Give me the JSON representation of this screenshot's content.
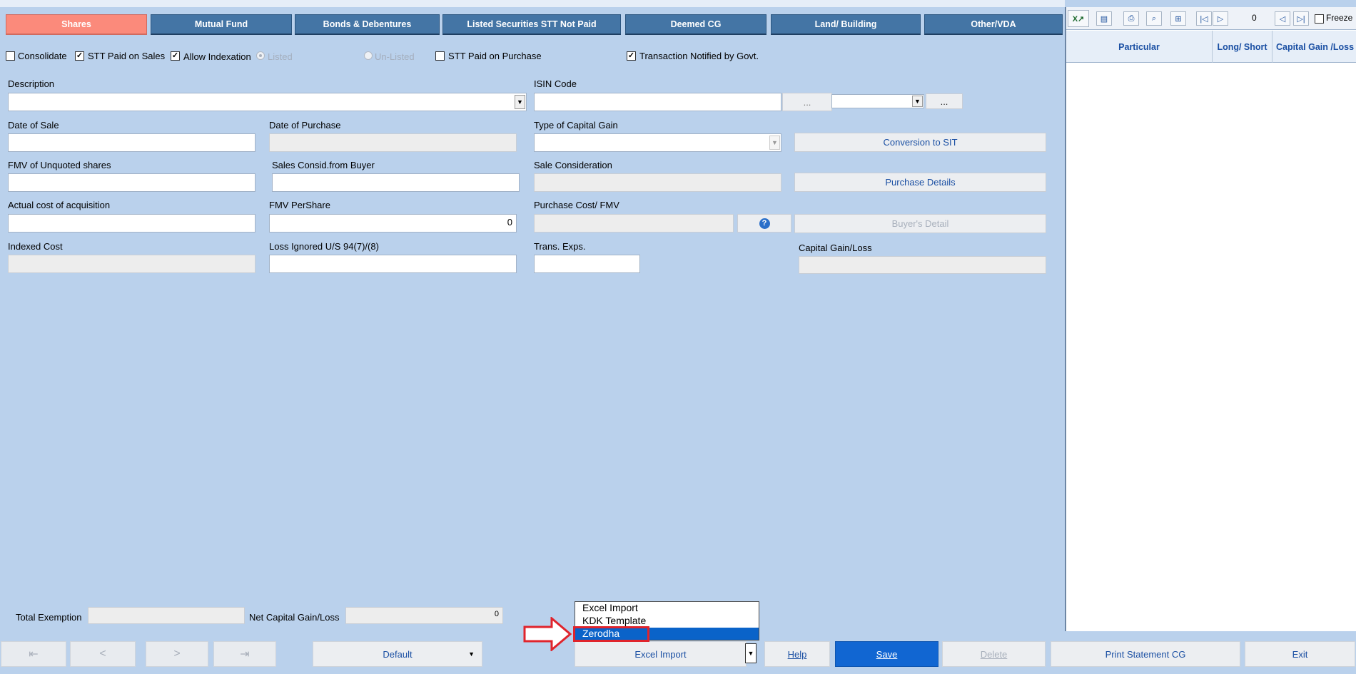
{
  "tabs": [
    {
      "label": "Shares",
      "active": true
    },
    {
      "label": "Mutual Fund",
      "active": false
    },
    {
      "label": "Bonds & Debentures",
      "active": false
    },
    {
      "label": "Listed Securities STT Not Paid",
      "active": false
    },
    {
      "label": "Deemed CG",
      "active": false
    },
    {
      "label": "Land/ Building",
      "active": false
    },
    {
      "label": "Other/VDA",
      "active": false
    }
  ],
  "options": {
    "consolidate": {
      "label": "Consolidate",
      "checked": false
    },
    "stt_paid_on_sales": {
      "label": "STT Paid on Sales",
      "checked": true
    },
    "allow_indexation": {
      "label": "Allow Indexation",
      "checked": true
    },
    "listed": {
      "label": "Listed",
      "selected": true,
      "disabled": true
    },
    "unlisted": {
      "label": "Un-Listed",
      "selected": false,
      "disabled": true
    },
    "stt_paid_on_purchase": {
      "label": "STT Paid on Purchase",
      "checked": false
    },
    "transaction_notified": {
      "label": "Transaction Notified by Govt.",
      "checked": true
    }
  },
  "form": {
    "description": {
      "label": "Description",
      "value": ""
    },
    "isin_code": {
      "label": "ISIN Code",
      "value": "",
      "browse": "...",
      "browse2": "..."
    },
    "date_of_sale": {
      "label": "Date of Sale",
      "value": ""
    },
    "date_of_purchase": {
      "label": "Date of Purchase",
      "value": ""
    },
    "type_of_capital_gain": {
      "label": "Type of Capital Gain",
      "value": ""
    },
    "conversion_to_sit": "Conversion to SIT",
    "fmv_unquoted": {
      "label": "FMV of Unquoted shares",
      "value": ""
    },
    "sales_consid_buyer": {
      "label": "Sales Consid.from Buyer",
      "value": ""
    },
    "sale_consideration": {
      "label": "Sale Consideration",
      "value": ""
    },
    "purchase_details": "Purchase Details",
    "actual_cost": {
      "label": "Actual cost of acquisition",
      "value": ""
    },
    "fmv_per_share": {
      "label": "FMV PerShare",
      "value": "0"
    },
    "purchase_cost_fmv": {
      "label": "Purchase Cost/ FMV",
      "value": ""
    },
    "help_icon": "?",
    "buyers_detail": "Buyer's Detail",
    "indexed_cost": {
      "label": "Indexed Cost",
      "value": ""
    },
    "loss_ignored": {
      "label": "Loss Ignored U/S 94(7)/(8)",
      "value": ""
    },
    "trans_exps": {
      "label": "Trans. Exps.",
      "value": ""
    },
    "capital_gain_loss": {
      "label": "Capital Gain/Loss",
      "value": ""
    }
  },
  "totals": {
    "total_exemption": {
      "label": "Total Exemption",
      "value": ""
    },
    "net_capital_gain": {
      "label": "Net Capital Gain/Loss",
      "value": "0"
    }
  },
  "right_pane": {
    "page_number": "0",
    "freeze_label": "Freeze",
    "columns": [
      "Particular",
      "Long/ Short",
      "Capital Gain /Loss"
    ]
  },
  "bottom": {
    "nav_first": "⇤",
    "nav_prev": "<",
    "nav_next": ">",
    "nav_last": "⇥",
    "default_select": "Default",
    "import_select": "Excel Import",
    "help": "Help",
    "save": "Save",
    "delete": "Delete",
    "print_statement": "Print Statement CG",
    "exit": "Exit"
  },
  "import_dropdown": {
    "items": [
      "Excel Import",
      "KDK Template",
      "Zerodha"
    ],
    "selected": "Zerodha"
  },
  "colors": {
    "background": "#bad1ec",
    "tab": "#4475a5",
    "active_tab": "#fb8a7b",
    "save": "#1166d2",
    "annotation": "#e0242c"
  }
}
